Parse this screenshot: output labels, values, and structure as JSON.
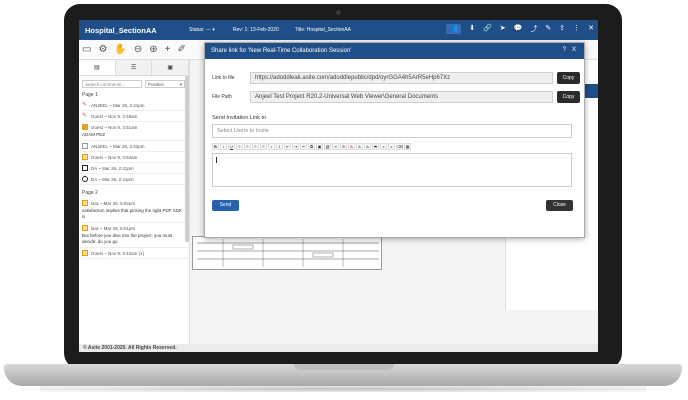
{
  "topbar": {
    "app_title": "Hospital_SectionAA",
    "status": "Status: --- ▾",
    "rev": "Rev: 1: 13-Feb-2020",
    "title": "Title: Hospital_SectionAA"
  },
  "sidebar": {
    "search_placeholder": "Search comments...",
    "position_select": "Position",
    "page1_label": "Page 1",
    "page2_label": "Page 2",
    "comments": [
      {
        "meta": "ANJEEL ~ Mar 26, 2:41pm",
        "body": "",
        "color": "#d9534f",
        "icon": "pin-icon"
      },
      {
        "meta": "Guest ~ Nov 9, 3:49am",
        "body": "",
        "color": "#d9534f",
        "icon": "pin-icon"
      },
      {
        "meta": "Guest ~ Nov 9, 3:51am",
        "body": "ADAM PEZ",
        "color": "#e0a31c",
        "icon": "text-box-icon"
      },
      {
        "meta": "ANJEEL ~ Mar 26, 2:43pm",
        "body": "",
        "color": "#999999",
        "icon": "square-icon"
      },
      {
        "meta": "Guest ~ Nov 9, 3:52am",
        "body": "",
        "color": "#e0a31c",
        "icon": "note-icon"
      },
      {
        "meta": "DA ~ Mar 26, 2:41pm",
        "body": "",
        "color": "#222222",
        "icon": "square-icon"
      },
      {
        "meta": "DA ~ Mar 26, 2:41pm",
        "body": "",
        "color": "#222222",
        "icon": "circle-icon"
      },
      {
        "meta": "lara ~ Mar 26, 5:02pm",
        "body": "satisfaction implies that picking the right PDF SDK is",
        "color": "#e0a31c",
        "icon": "note-icon"
      },
      {
        "meta": "lara ~ Mar 26, 5:01pm",
        "body": "But before you dive into the project, you must decide: do you go",
        "color": "#e0a31c",
        "icon": "note-icon"
      },
      {
        "meta": "Guest ~ Nov 9, 3:42am (1)",
        "body": "",
        "color": "#e0a31c",
        "icon": "note-icon"
      }
    ]
  },
  "footer": {
    "copyright": "© Asite 2001-2020. All Rights Reserved."
  },
  "modal": {
    "title": "Share link for 'New Real-Time Collaboration Session'",
    "help": "?",
    "close_x": "X",
    "link_label": "Link to file",
    "link_value": "https://adoddleak.asite.com/adoddlepublic/dpd/oyrGGA4h5ArR5eHp67Xz",
    "copy_label": "Copy",
    "path_label": "File Path",
    "path_value": "Anjeel Test Project R20.2-Universal Web Viewer\\General Documents",
    "invite_label": "Send Invitation Link to",
    "invite_placeholder": "Select Users to Invite",
    "send_label": "Send",
    "close_label": "Close"
  },
  "colors": {
    "brand": "#1f4e89",
    "send": "#2561ad"
  }
}
